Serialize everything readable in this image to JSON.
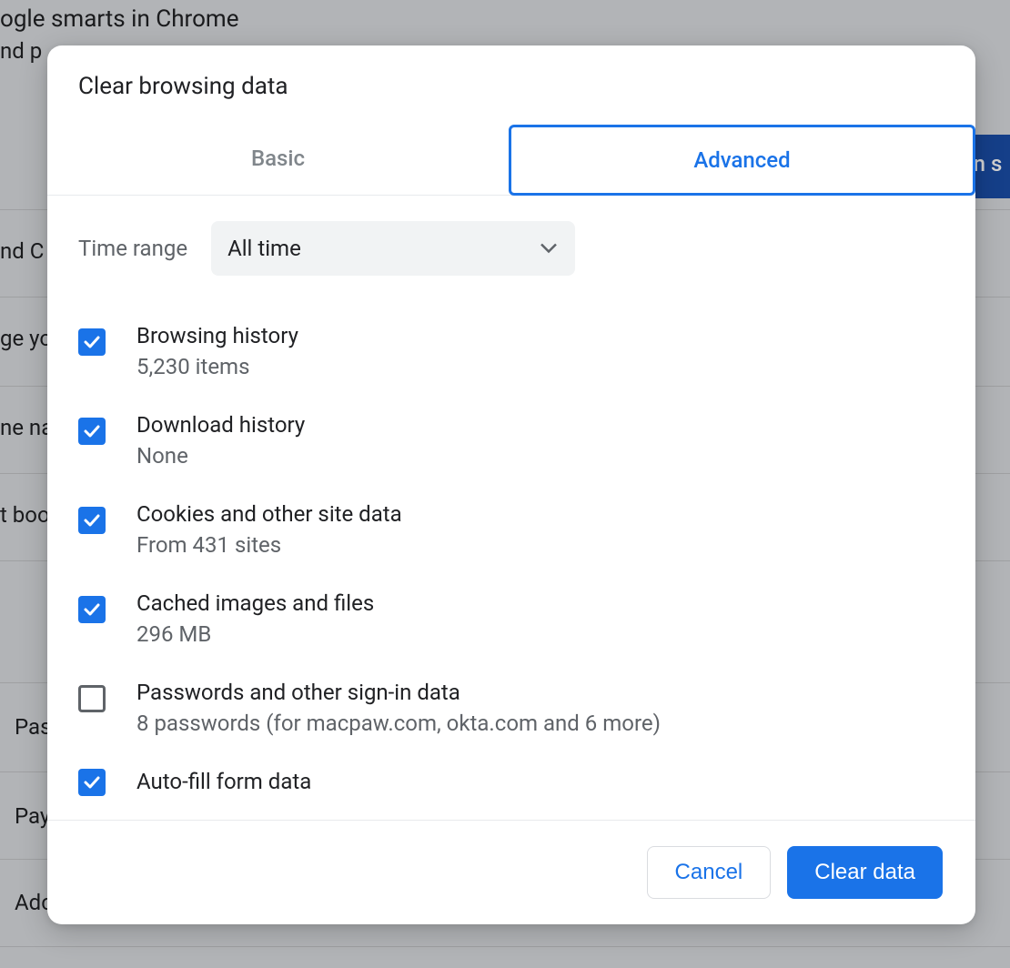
{
  "backdrop": {
    "heading_frag": "ogle smarts in Chrome",
    "subline_frag": "nd p",
    "rows": [
      "nd C",
      "ge yo",
      "ne na",
      "t boo"
    ],
    "lower": [
      "Pas",
      "Pay",
      "Adc"
    ],
    "banner_frag": "on s"
  },
  "dialog": {
    "title": "Clear browsing data",
    "tabs": {
      "basic": "Basic",
      "advanced": "Advanced"
    },
    "time_range": {
      "label": "Time range",
      "value": "All time"
    },
    "options": [
      {
        "title": "Browsing history",
        "desc": "5,230 items",
        "checked": true
      },
      {
        "title": "Download history",
        "desc": "None",
        "checked": true
      },
      {
        "title": "Cookies and other site data",
        "desc": "From 431 sites",
        "checked": true
      },
      {
        "title": "Cached images and files",
        "desc": "296 MB",
        "checked": true
      },
      {
        "title": "Passwords and other sign-in data",
        "desc": "8 passwords (for macpaw.com, okta.com and 6 more)",
        "checked": false
      },
      {
        "title": "Auto-fill form data",
        "desc": "",
        "checked": true
      }
    ],
    "buttons": {
      "cancel": "Cancel",
      "clear": "Clear data"
    }
  }
}
